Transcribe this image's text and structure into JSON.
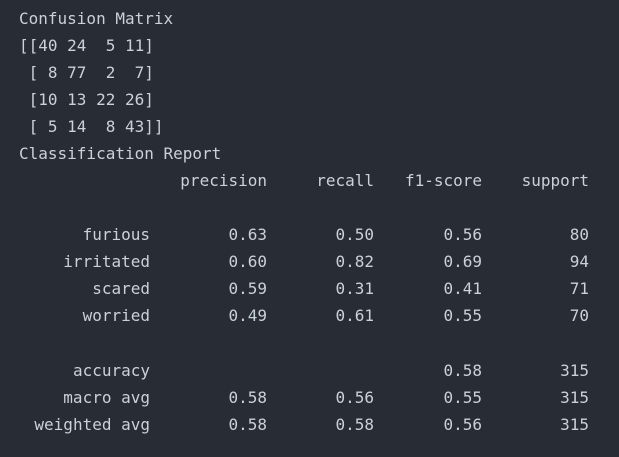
{
  "confusion_title": "Confusion Matrix",
  "matrix_lines": [
    "[[40 24  5 11]",
    " [ 8 77  2  7]",
    " [10 13 22 26]",
    " [ 5 14  8 43]]"
  ],
  "report_title": "Classification Report",
  "headers": {
    "precision": "precision",
    "recall": "recall",
    "f1": "f1-score",
    "support": "support"
  },
  "class_rows": [
    {
      "label": "furious",
      "precision": "0.63",
      "recall": "0.50",
      "f1": "0.56",
      "support": "80"
    },
    {
      "label": "irritated",
      "precision": "0.60",
      "recall": "0.82",
      "f1": "0.69",
      "support": "94"
    },
    {
      "label": "scared",
      "precision": "0.59",
      "recall": "0.31",
      "f1": "0.41",
      "support": "71"
    },
    {
      "label": "worried",
      "precision": "0.49",
      "recall": "0.61",
      "f1": "0.55",
      "support": "70"
    }
  ],
  "summary_rows": [
    {
      "label": "accuracy",
      "precision": "",
      "recall": "",
      "f1": "0.58",
      "support": "315"
    },
    {
      "label": "macro avg",
      "precision": "0.58",
      "recall": "0.56",
      "f1": "0.55",
      "support": "315"
    },
    {
      "label": "weighted avg",
      "precision": "0.58",
      "recall": "0.58",
      "f1": "0.56",
      "support": "315"
    }
  ],
  "colors": {
    "background": "#282c34",
    "text": "#c9d1d9"
  }
}
